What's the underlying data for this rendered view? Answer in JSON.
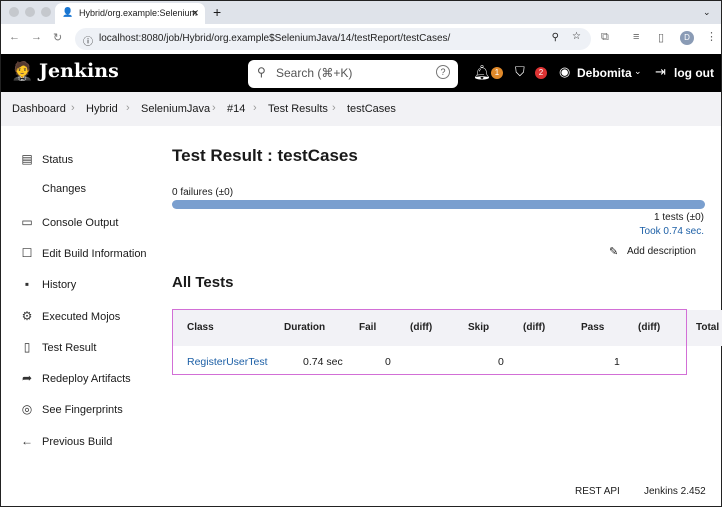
{
  "browser": {
    "tab_title": "Hybrid/org.example:Selenium",
    "url": "localhost:8080/job/Hybrid/org.example$SeleniumJava/14/testReport/testCases/",
    "profile_initial": "D"
  },
  "header": {
    "logo": "Jenkins",
    "search_placeholder": "Search (⌘+K)",
    "notifications": "1",
    "security": "2",
    "user": "Debomita",
    "logout": "log out"
  },
  "breadcrumb": [
    "Dashboard",
    "Hybrid",
    "SeleniumJava",
    "#14",
    "Test Results",
    "testCases"
  ],
  "sidebar": [
    {
      "label": "Status",
      "icon": "document-icon"
    },
    {
      "label": "Changes",
      "icon": "code-icon"
    },
    {
      "label": "Console Output",
      "icon": "terminal-icon"
    },
    {
      "label": "Edit Build Information",
      "icon": "edit-icon"
    },
    {
      "label": "History",
      "icon": "history-icon"
    },
    {
      "label": "Executed Mojos",
      "icon": "gear-icon"
    },
    {
      "label": "Test Result",
      "icon": "clipboard-icon"
    },
    {
      "label": "Redeploy Artifacts",
      "icon": "redeploy-icon"
    },
    {
      "label": "See Fingerprints",
      "icon": "fingerprint-icon"
    },
    {
      "label": "Previous Build",
      "icon": "arrow-left-icon"
    }
  ],
  "main": {
    "title": "Test Result : testCases",
    "failures": "0 failures (±0)",
    "pass_fraction": 1.0,
    "bar_color": "#7a9fcf",
    "tests": "1 tests (±0)",
    "took": "Took 0.74 sec.",
    "add_description": "Add description",
    "all_tests": "All Tests",
    "columns": [
      "Class",
      "Duration",
      "Fail",
      "(diff)",
      "Skip",
      "(diff)",
      "Pass",
      "(diff)",
      "Total"
    ],
    "rows": [
      {
        "class": "RegisterUserTest",
        "duration": "0.74 sec",
        "fail": "0",
        "skip": "0",
        "pass": "1"
      }
    ]
  },
  "footer": {
    "rest_api": "REST API",
    "version": "Jenkins 2.452"
  }
}
